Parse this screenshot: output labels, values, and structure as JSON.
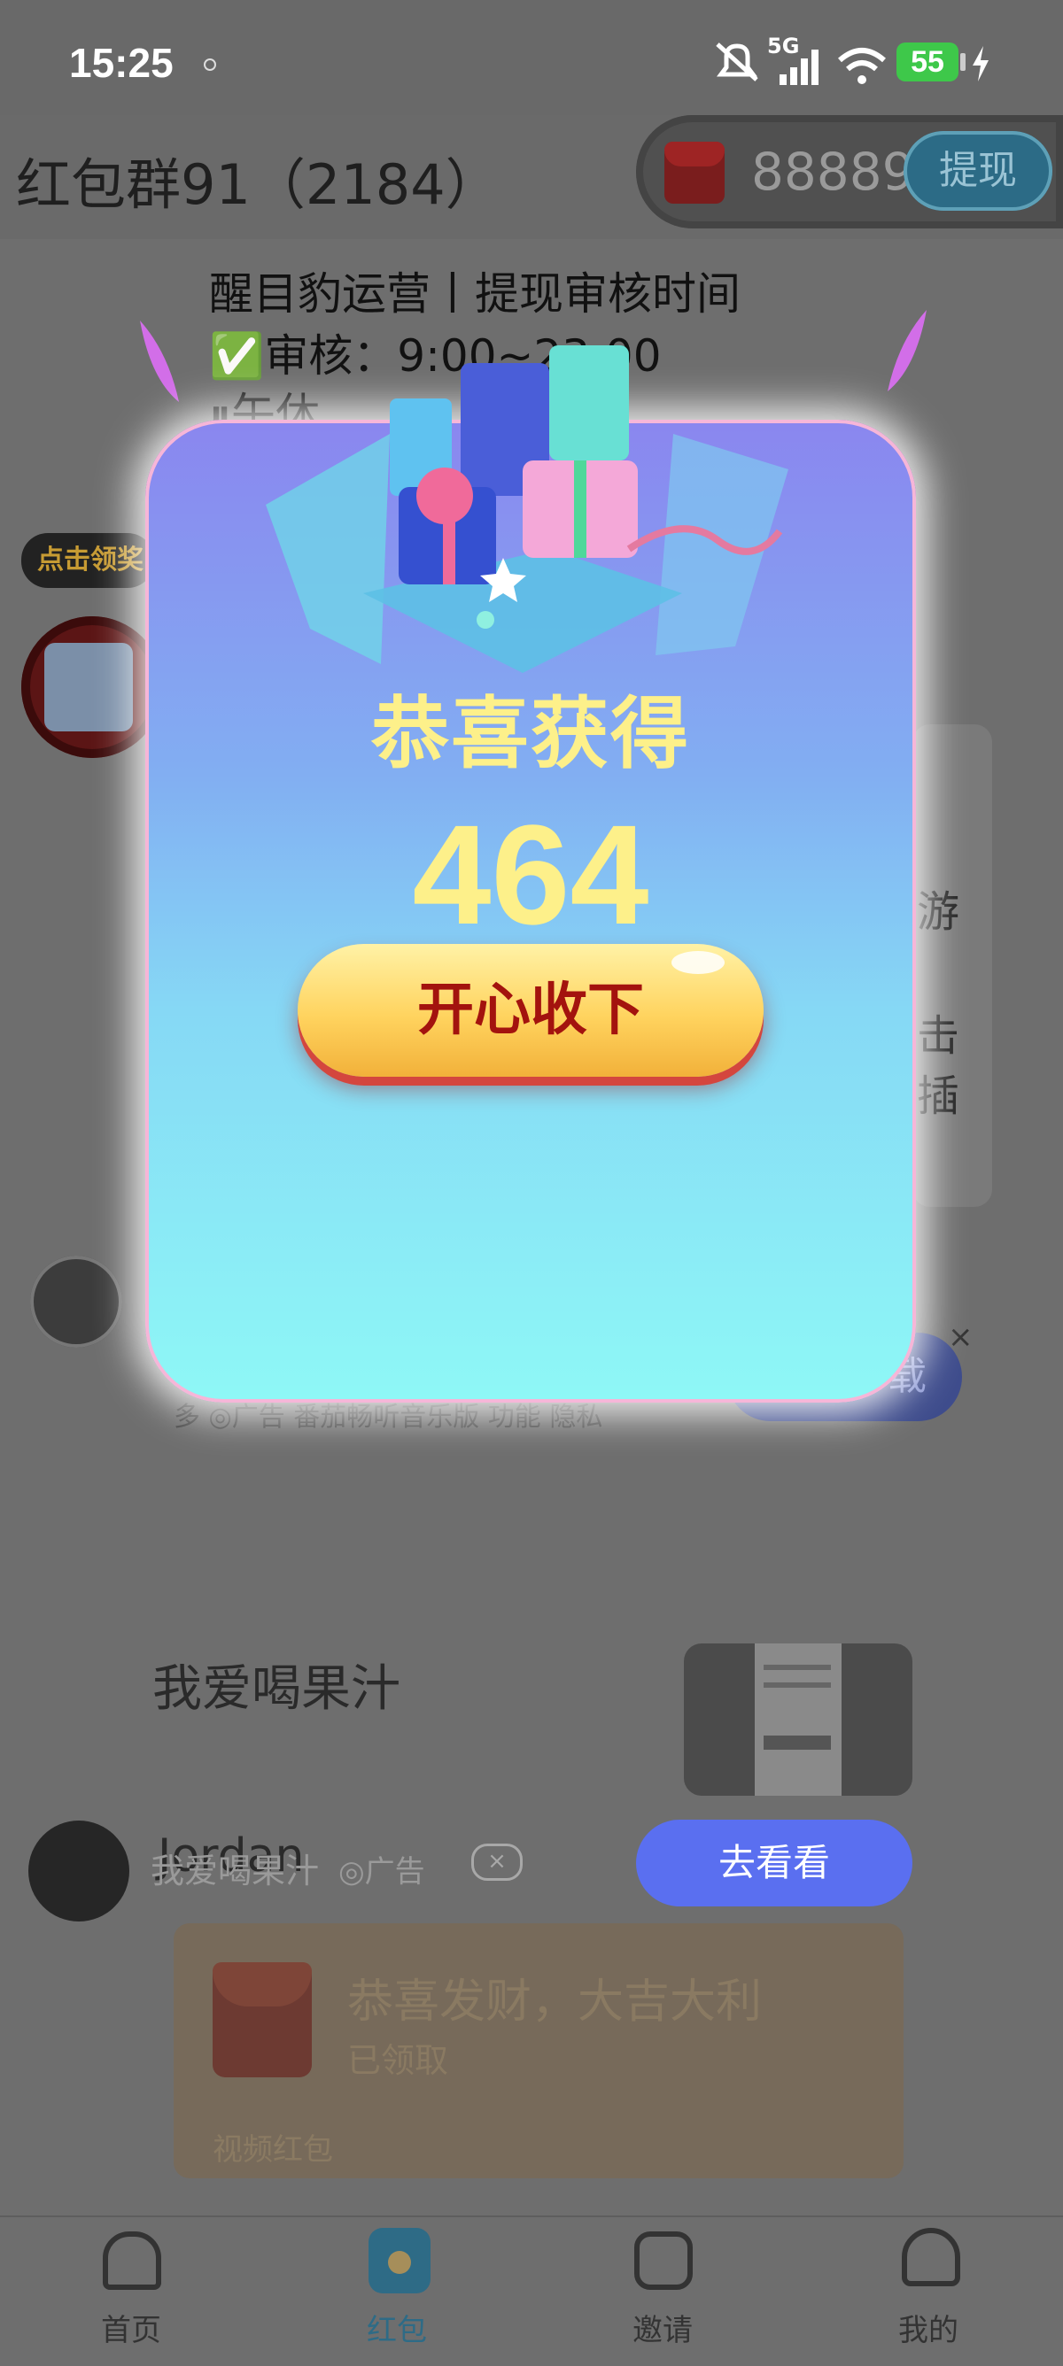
{
  "status_bar": {
    "time": "15:25",
    "network": "5G",
    "battery": "55",
    "icons": [
      "mute-bell-icon",
      "signal-icon",
      "wifi-icon",
      "charging-icon"
    ]
  },
  "header": {
    "chat_title": "红包群91（2184）",
    "wallet_amount": "88889",
    "withdraw_label": "提现"
  },
  "background": {
    "notice_lines": [
      "醒目豹运营丨提现审核时间",
      "✅审核：9:00~23:00",
      "⏸午休"
    ],
    "tip_bubble": "点击领奖",
    "right_fragments": [
      "游",
      "击",
      "插"
    ],
    "ad_close": "×",
    "ad_download_label": "载",
    "ad_strip_text": "多 ◎广告   番茄畅听音乐版 功能 隐私",
    "ad2": {
      "title": "我爱喝果汁",
      "source": "我爱喝果汁",
      "ad_label": "◎广告",
      "close": "×",
      "cta": "去看看"
    },
    "user_name": "Jordan",
    "envelope": {
      "title": "恭喜发财，大吉大利",
      "status": "已领取",
      "type": "视频红包"
    }
  },
  "tabbar": {
    "tabs": [
      {
        "label": "首页",
        "icon": "home-icon"
      },
      {
        "label": "红包",
        "icon": "red-packet-icon",
        "active": true
      },
      {
        "label": "邀请",
        "icon": "invite-icon"
      },
      {
        "label": "我的",
        "icon": "profile-icon"
      }
    ]
  },
  "modal": {
    "title": "恭喜获得",
    "amount": "464",
    "button_label": "开心收下"
  },
  "colors": {
    "modal_title": "#fdf08a",
    "button_text": "#a3130e",
    "goto_button": "#5a6ff0"
  }
}
